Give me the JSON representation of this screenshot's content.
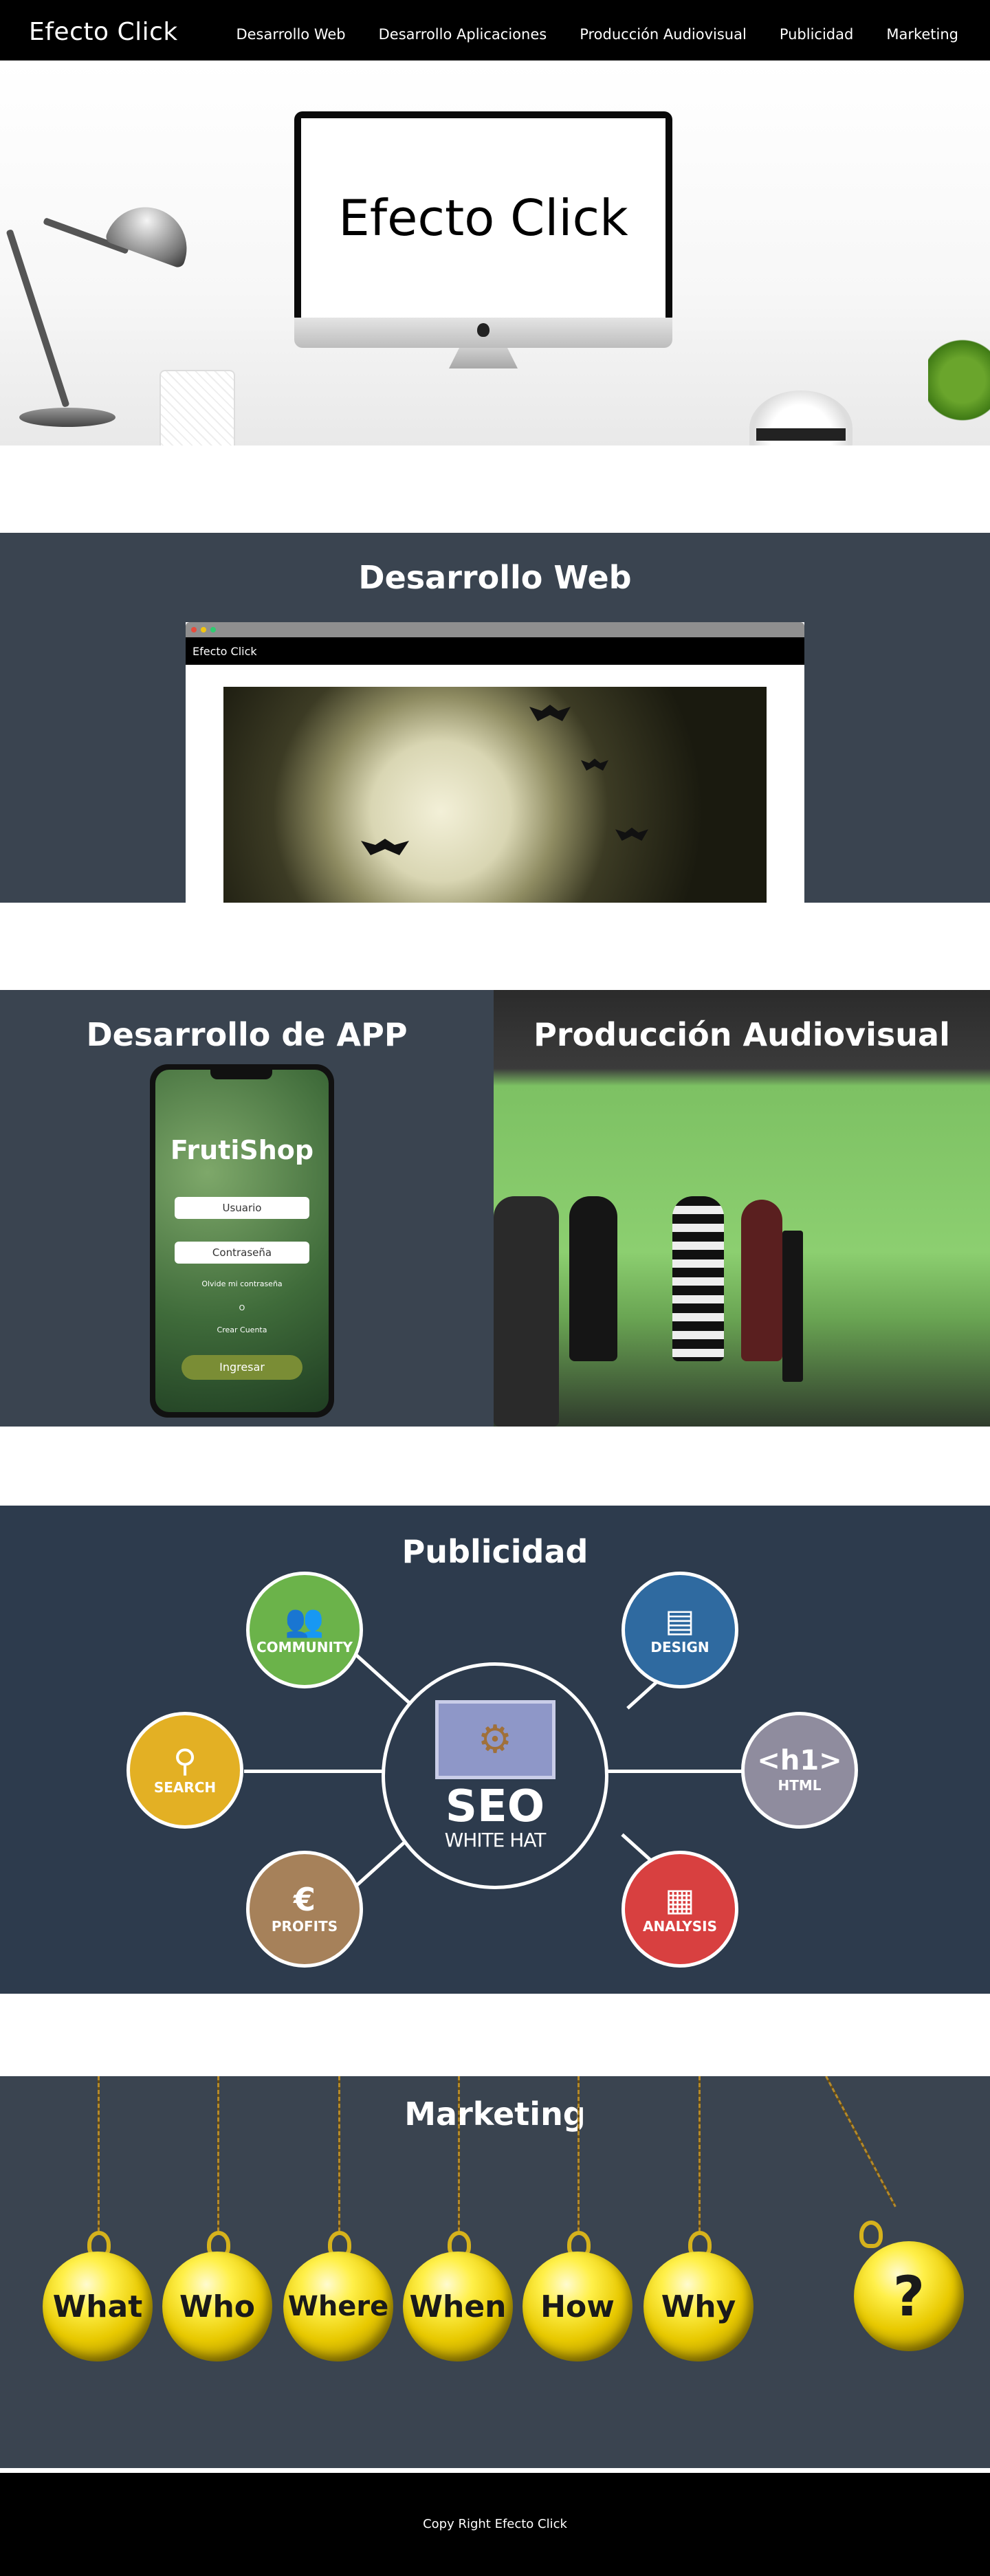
{
  "nav": {
    "brand": "Efecto Click",
    "items": [
      "Desarrollo Web",
      "Desarrollo Aplicaciones",
      "Producción Audiovisual",
      "Publicidad",
      "Marketing"
    ]
  },
  "hero": {
    "screen_text": "Efecto Click"
  },
  "web": {
    "title": "Desarrollo Web",
    "browser_header": "Efecto Click"
  },
  "app": {
    "title": "Desarrollo de APP",
    "app_name": "FrutiShop",
    "user_placeholder": "Usuario",
    "password_placeholder": "Contraseña",
    "forgot": "Olvide mi contraseña",
    "or": "O",
    "create": "Crear Cuenta",
    "login": "Ingresar"
  },
  "audiovisual": {
    "title": "Producción Audiovisual"
  },
  "pub": {
    "title": "Publicidad",
    "center_big": "SEO",
    "center_small": "WHITE HAT",
    "nodes": [
      {
        "label": "COMMUNITY",
        "icon": "👥",
        "color": "#6bb34a"
      },
      {
        "label": "DESIGN",
        "icon": "▤",
        "color": "#2f6aa0"
      },
      {
        "label": "SEARCH",
        "icon": "⚲",
        "color": "#e3b024"
      },
      {
        "label": "HTML",
        "icon": "<h1>",
        "color": "#8f8c9e"
      },
      {
        "label": "PROFITS",
        "icon": "€",
        "color": "#a6815a"
      },
      {
        "label": "ANALYSIS",
        "icon": "▦",
        "color": "#d84040"
      }
    ]
  },
  "mkt": {
    "title": "Marketing",
    "balls": [
      "What",
      "Who",
      "Where",
      "When",
      "How",
      "Why",
      "?"
    ]
  },
  "footer": {
    "text": "Copy Right Efecto Click"
  }
}
